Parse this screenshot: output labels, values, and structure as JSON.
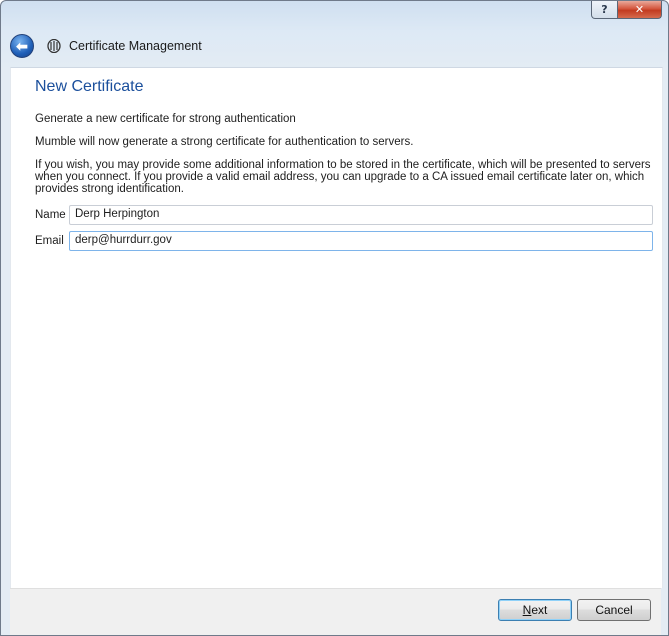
{
  "window": {
    "title": "Certificate Management",
    "help_glyph": "?",
    "close_glyph": "✕"
  },
  "header": {
    "back_glyph": "⬅"
  },
  "page": {
    "title": "New Certificate",
    "subtitle": "Generate a new certificate for strong authentication",
    "intro": "Mumble will now generate a strong certificate for authentication to servers.",
    "info": "If you wish, you may provide some additional information to be stored in the certificate, which will be presented to servers when you connect. If you provide a valid email address, you can upgrade to a CA issued email certificate later on, which provides strong identification."
  },
  "form": {
    "name_label": "Name",
    "name_value": "Derp Herpington",
    "email_label": "Email",
    "email_value": "derp@hurrdurr.gov"
  },
  "buttons": {
    "next": "Next",
    "cancel": "Cancel"
  },
  "colors": {
    "title_blue": "#1b4f9c",
    "close_red": "#c23b20",
    "focus_border": "#7eb4ea"
  }
}
